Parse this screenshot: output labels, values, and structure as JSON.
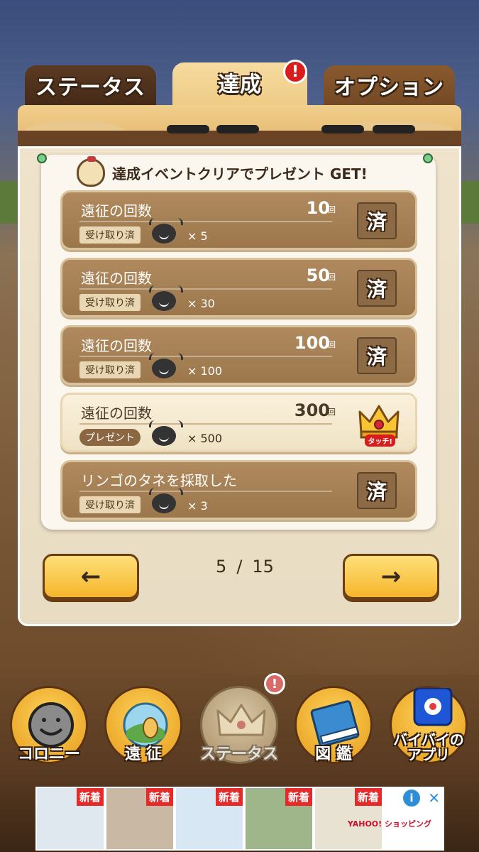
{
  "tabs": [
    {
      "label": "ステータス"
    },
    {
      "label": "達成",
      "alert": "!"
    },
    {
      "label": "オプション"
    }
  ],
  "header": {
    "text": "達成イベントクリアでプレゼント GET!"
  },
  "rows": [
    {
      "title": "遠征の回数",
      "count": "10",
      "unit": "回",
      "status": "受け取り済",
      "qty": "× 5",
      "badge": "済"
    },
    {
      "title": "遠征の回数",
      "count": "50",
      "unit": "回",
      "status": "受け取り済",
      "qty": "× 30",
      "badge": "済"
    },
    {
      "title": "遠征の回数",
      "count": "100",
      "unit": "回",
      "status": "受け取り済",
      "qty": "× 100",
      "badge": "済"
    },
    {
      "title": "遠征の回数",
      "count": "300",
      "unit": "回",
      "status": "プレゼント",
      "qty": "× 500",
      "badge_label": "タッチ!"
    },
    {
      "title": "リンゴのタネを採取した",
      "count": "",
      "unit": "",
      "status": "受け取り済",
      "qty": "× 3",
      "badge": "済"
    }
  ],
  "pagination": {
    "current": "5",
    "separator": "/",
    "total": "15",
    "prev": "←",
    "next": "→"
  },
  "nav": [
    {
      "label": "コロニー"
    },
    {
      "label": "遠 征"
    },
    {
      "label": "ステータス",
      "alert": "!"
    },
    {
      "label": "図 鑑"
    },
    {
      "label": "バイバイの\nアプリ"
    }
  ],
  "ad": {
    "new_label": "新着",
    "brand": "YAHOO! ショッピング",
    "info": "i",
    "close": "✕"
  }
}
